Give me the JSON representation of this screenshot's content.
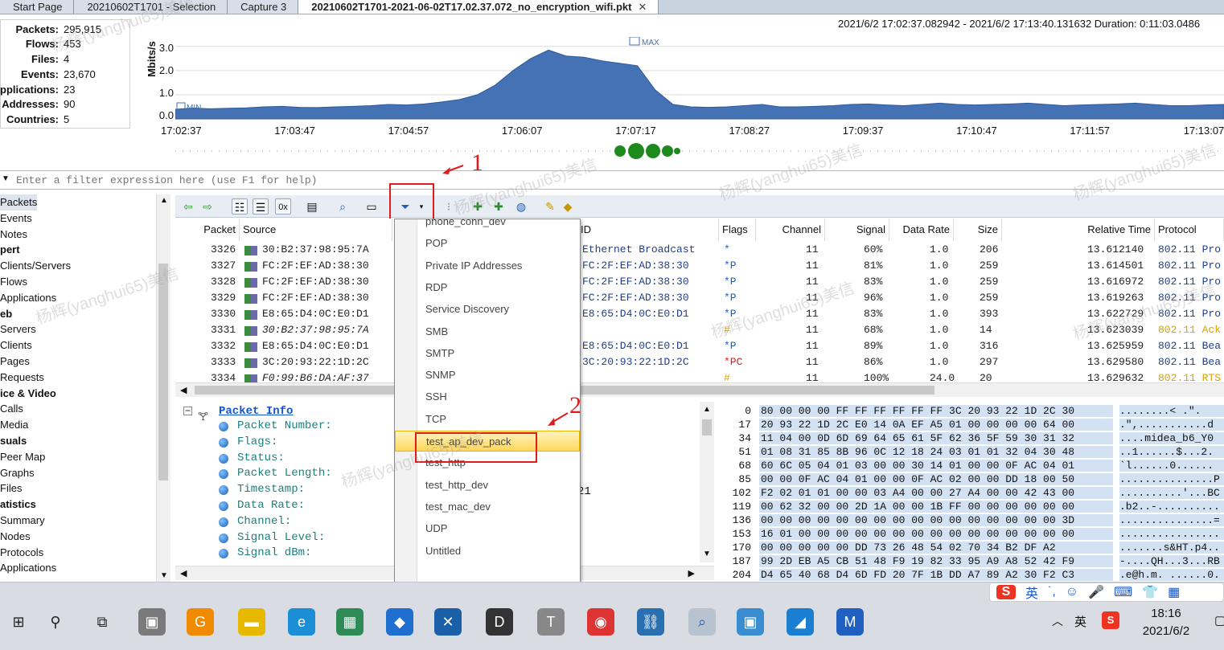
{
  "tabs": [
    {
      "label": "Start Page"
    },
    {
      "label": "20210602T1701 - Selection"
    },
    {
      "label": "Capture 3"
    },
    {
      "label": "20210602T1701-2021-06-02T17.02.37.072_no_encryption_wifi.pkt",
      "close": "✕"
    }
  ],
  "stats": [
    {
      "key": "Packets:",
      "value": "295,915"
    },
    {
      "key": "Flows:",
      "value": "453"
    },
    {
      "key": "Files:",
      "value": "4"
    },
    {
      "key": "Events:",
      "value": "23,670"
    },
    {
      "key": "Applications:",
      "value": "23"
    },
    {
      "key": "Addresses:",
      "value": "90"
    },
    {
      "key": "Countries:",
      "value": "5"
    }
  ],
  "time_range": "2021/6/2 17:02:37.082942 - 2021/6/2 17:13:40.131632  Duration: 0:11:03.0486",
  "chart_data": {
    "type": "area",
    "ylabel": "Mbits/s",
    "yticks": [
      "3.0",
      "2.0",
      "1.0",
      "0.0"
    ],
    "ylim": [
      0,
      3.0
    ],
    "x": [
      "17:02:37",
      "17:03:47",
      "17:04:57",
      "17:06:07",
      "17:07:17",
      "17:08:27",
      "17:09:37",
      "17:10:47",
      "17:11:57",
      "17:13:07"
    ],
    "annotations": [
      "MAX",
      "MIN"
    ],
    "values": [
      0.4,
      0.45,
      0.42,
      0.44,
      0.46,
      0.5,
      0.52,
      0.48,
      0.47,
      0.5,
      0.52,
      0.55,
      0.6,
      0.58,
      0.62,
      0.7,
      0.8,
      1.0,
      1.4,
      2.0,
      2.5,
      2.85,
      2.6,
      2.55,
      2.4,
      2.3,
      2.2,
      1.2,
      0.6,
      0.5,
      0.48,
      0.5,
      0.55,
      0.6,
      0.5,
      0.5,
      0.52,
      0.55,
      0.6,
      0.62,
      0.58,
      0.55,
      0.6,
      0.65,
      0.6,
      0.58,
      0.6,
      0.62,
      0.65,
      0.6,
      0.55,
      0.58,
      0.6,
      0.62,
      0.65,
      0.6,
      0.55,
      0.55,
      0.58,
      0.6
    ],
    "color": "#4472b4"
  },
  "filter": {
    "placeholder": "Enter a filter expression here (use F1 for help)"
  },
  "nav": [
    {
      "label": "Packets",
      "type": "item",
      "selected": true
    },
    {
      "label": "Events",
      "type": "item"
    },
    {
      "label": "Notes",
      "type": "item"
    },
    {
      "label": "pert",
      "type": "header"
    },
    {
      "label": "Clients/Servers",
      "type": "item"
    },
    {
      "label": "Flows",
      "type": "item"
    },
    {
      "label": "Applications",
      "type": "item"
    },
    {
      "label": "eb",
      "type": "header"
    },
    {
      "label": "Servers",
      "type": "item"
    },
    {
      "label": "Clients",
      "type": "item"
    },
    {
      "label": "Pages",
      "type": "item"
    },
    {
      "label": "Requests",
      "type": "item"
    },
    {
      "label": "ice & Video",
      "type": "header"
    },
    {
      "label": "Calls",
      "type": "item"
    },
    {
      "label": "Media",
      "type": "item"
    },
    {
      "label": "suals",
      "type": "header"
    },
    {
      "label": "Peer Map",
      "type": "item"
    },
    {
      "label": "Graphs",
      "type": "item"
    },
    {
      "label": "Files",
      "type": "item"
    },
    {
      "label": "atistics",
      "type": "header"
    },
    {
      "label": "Summary",
      "type": "item"
    },
    {
      "label": "Nodes",
      "type": "item"
    },
    {
      "label": "Protocols",
      "type": "item"
    },
    {
      "label": "Applications",
      "type": "item"
    }
  ],
  "grid": {
    "columns": [
      "Packet",
      "Source",
      "ID",
      "Flags",
      "Channel",
      "Signal",
      "Data Rate",
      "Size",
      "Relative Time",
      "Protocol"
    ],
    "rows": [
      {
        "packet": "3326",
        "source": "30:B2:37:98:95:7A",
        "id": "Ethernet Broadcast",
        "flags": "*",
        "channel": "11",
        "signal": "60%",
        "rate": "1.0",
        "size": "206",
        "time": "13.612140",
        "proto": "802.11 Pro"
      },
      {
        "packet": "3327",
        "source": "FC:2F:EF:AD:38:30",
        "id": "FC:2F:EF:AD:38:30",
        "flags": "*P",
        "channel": "11",
        "signal": "81%",
        "rate": "1.0",
        "size": "259",
        "time": "13.614501",
        "proto": "802.11 Pro"
      },
      {
        "packet": "3328",
        "source": "FC:2F:EF:AD:38:30",
        "id": "FC:2F:EF:AD:38:30",
        "flags": "*P",
        "channel": "11",
        "signal": "83%",
        "rate": "1.0",
        "size": "259",
        "time": "13.616972",
        "proto": "802.11 Pro"
      },
      {
        "packet": "3329",
        "source": "FC:2F:EF:AD:38:30",
        "id": "FC:2F:EF:AD:38:30",
        "flags": "*P",
        "channel": "11",
        "signal": "96%",
        "rate": "1.0",
        "size": "259",
        "time": "13.619263",
        "proto": "802.11 Pro"
      },
      {
        "packet": "3330",
        "source": "E8:65:D4:0C:E0:D1",
        "id": "E8:65:D4:0C:E0:D1",
        "flags": "*P",
        "channel": "11",
        "signal": "83%",
        "rate": "1.0",
        "size": "393",
        "time": "13.622729",
        "proto": "802.11 Pro"
      },
      {
        "packet": "3331",
        "source": "30:B2:37:98:95:7A",
        "id": "",
        "flags": "#",
        "channel": "11",
        "signal": "68%",
        "rate": "1.0",
        "size": "14",
        "time": "13.623039",
        "proto": "802.11 Ack"
      },
      {
        "packet": "3332",
        "source": "E8:65:D4:0C:E0:D1",
        "id": "E8:65:D4:0C:E0:D1",
        "flags": "*P",
        "channel": "11",
        "signal": "89%",
        "rate": "1.0",
        "size": "316",
        "time": "13.625959",
        "proto": "802.11 Bea"
      },
      {
        "packet": "3333",
        "source": "3C:20:93:22:1D:2C",
        "id": "3C:20:93:22:1D:2C",
        "flags": "*PC",
        "channel": "11",
        "signal": "86%",
        "rate": "1.0",
        "size": "297",
        "time": "13.629580",
        "proto": "802.11 Bea"
      },
      {
        "packet": "3334",
        "source": "F0:99:B6:DA:AF:37",
        "id": "",
        "flags": "#",
        "channel": "11",
        "signal": "100%",
        "rate": "24.0",
        "size": "20",
        "time": "13.629632",
        "proto": "802.11 RTS"
      }
    ]
  },
  "tree": {
    "root": "Packet Info",
    "items": [
      "Packet Number:",
      "Flags:",
      "Status:",
      "Packet Length:",
      "Timestamp:",
      "Data Rate:",
      "Channel:",
      "Signal Level:",
      "Signal dBm:"
    ]
  },
  "hex": [
    {
      "off": "0",
      "bytes": "80 00 00 00 FF FF FF FF FF FF 3C 20 93 22 1D 2C 30",
      "asc": "........< .\"."
    },
    {
      "off": "17",
      "bytes": "20 93 22 1D 2C E0 14 0A EF A5 01 00 00 00 00 64 00",
      "asc": ".\",...........d"
    },
    {
      "off": "34",
      "bytes": "11 04 00 0D 6D 69 64 65 61 5F 62 36 5F 59 30 31 32",
      "asc": "....midea_b6_Y0"
    },
    {
      "off": "51",
      "bytes": "01 08 31 85 8B 96 0C 12 18 24 03 01 01 32 04 30 48",
      "asc": "..1......$...2."
    },
    {
      "off": "68",
      "bytes": "60 6C 05 04 01 03 00 00 30 14 01 00 00 0F AC 04 01",
      "asc": "`l......0......"
    },
    {
      "off": "85",
      "bytes": "00 00 0F AC 04 01 00 00 0F AC 02 00 00 DD 18 00 50",
      "asc": "...............P"
    },
    {
      "off": "102",
      "bytes": "F2 02 01 01 00 00 03 A4 00 00 27 A4 00 00 42 43 00",
      "asc": "..........'...BC"
    },
    {
      "off": "119",
      "bytes": "00 62 32 00 00 2D 1A 00 00 1B FF 00 00 00 00 00 00",
      "asc": ".b2..-.........."
    },
    {
      "off": "136",
      "bytes": "00 00 00 00 00 00 00 00 00 00 00 00 00 00 00 00 3D",
      "asc": "...............="
    },
    {
      "off": "153",
      "bytes": "16 01 00 00 00 00 00 00 00 00 00 00 00 00 00 00 00",
      "asc": "................"
    },
    {
      "off": "170",
      "bytes": "00 00 00 00 00 DD 73 26 48 54 02 70 34 B2 DF A2",
      "asc": ".......s&HT.p4.."
    },
    {
      "off": "187",
      "bytes": "99 2D EB A5 CB 51 48 F9 19 82 33 95 A9 A8 52 42 F9",
      "asc": "-....QH...3...RB"
    },
    {
      "off": "204",
      "bytes": "D4 65 40 68 D4 6D FD 20 7F 1B DD A7 89 A2 30 F2 C3",
      "asc": ".e@h.m. ......0."
    }
  ],
  "dropdown": {
    "items": [
      "phone_conn_dev",
      "POP",
      "Private IP Addresses",
      "RDP",
      "Service Discovery",
      "SMB",
      "SMTP",
      "SNMP",
      "SSH",
      "TCP",
      "test_ap_dev_pack",
      "test_http",
      "test_http_dev",
      "test_mac_dev",
      "UDP",
      "Untitled"
    ],
    "highlighted": "test_ap_dev_pack"
  },
  "annotations": {
    "one": "1",
    "two": "2"
  },
  "extra_value": "21",
  "taskbar": {
    "icons": [
      "start-icon",
      "search-icon",
      "task-view-icon",
      "app1-icon",
      "app2-icon",
      "explorer-icon",
      "edge-icon",
      "app3-icon",
      "app4-icon",
      "app5-icon",
      "app6-icon",
      "app7-icon",
      "chrome-icon",
      "network-icon",
      "omnipeek-icon",
      "app8-icon",
      "app9-icon",
      "app10-icon"
    ],
    "ime": {
      "lang": "英",
      "lang2": "英"
    },
    "time": "18:16",
    "date": "2021/6/2"
  },
  "watermark": "杨辉(yanghui65)美信",
  "colors": {
    "accent": "#4472b4",
    "red": "#e01b1b",
    "highlight": "#ffd75a",
    "hex_bg": "#d3e2f2"
  }
}
